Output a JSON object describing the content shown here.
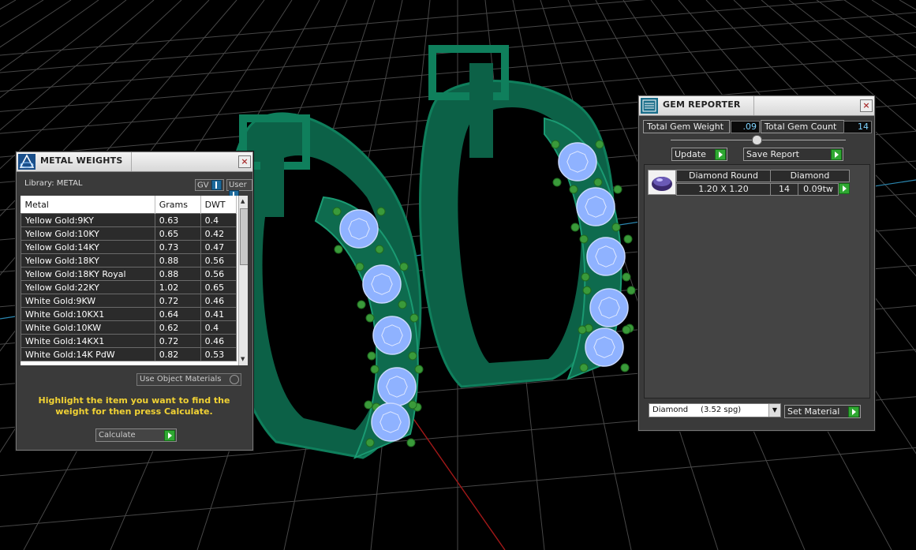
{
  "metal_weights": {
    "title": "METAL WEIGHTS",
    "close": "×",
    "library_label": "Library: METAL",
    "gv_label": "GV",
    "user_label": "User",
    "columns": [
      "Metal",
      "Grams",
      "DWT"
    ],
    "rows": [
      [
        "Yellow Gold:9KY",
        "0.63",
        "0.4"
      ],
      [
        "Yellow Gold:10KY",
        "0.65",
        "0.42"
      ],
      [
        "Yellow Gold:14KY",
        "0.73",
        "0.47"
      ],
      [
        "Yellow Gold:18KY",
        "0.88",
        "0.56"
      ],
      [
        "Yellow Gold:18KY Royal",
        "0.88",
        "0.56"
      ],
      [
        "Yellow Gold:22KY",
        "1.02",
        "0.65"
      ],
      [
        "White Gold:9KW",
        "0.72",
        "0.46"
      ],
      [
        "White Gold:10KX1",
        "0.64",
        "0.41"
      ],
      [
        "White Gold:10KW",
        "0.62",
        "0.4"
      ],
      [
        "White Gold:14KX1",
        "0.72",
        "0.46"
      ],
      [
        "White Gold:14K PdW",
        "0.82",
        "0.53"
      ]
    ],
    "use_object_materials": "Use Object Materials",
    "hint": "Highlight the item you want to find the weight for then press Calculate.",
    "calculate_label": "Calculate"
  },
  "gem_reporter": {
    "title": "GEM REPORTER",
    "close": "×",
    "total_weight_label": "Total Gem Weight",
    "total_weight_value": ".09",
    "total_count_label": "Total Gem Count",
    "total_count_value": "14",
    "update_label": "Update",
    "save_report_label": "Save Report",
    "gem": {
      "shape": "Diamond Round",
      "size": "1.20 X 1.20",
      "material": "Diamond",
      "count": "14",
      "weight": "0.09tw"
    },
    "material_select": "Diamond     (3.52 spg)",
    "set_material_label": "Set Material"
  },
  "colors": {
    "metal": "#0e6b4e",
    "gem": "#8fb2ff",
    "prong": "#3a9a3a",
    "grid": "#4a4a4a"
  }
}
